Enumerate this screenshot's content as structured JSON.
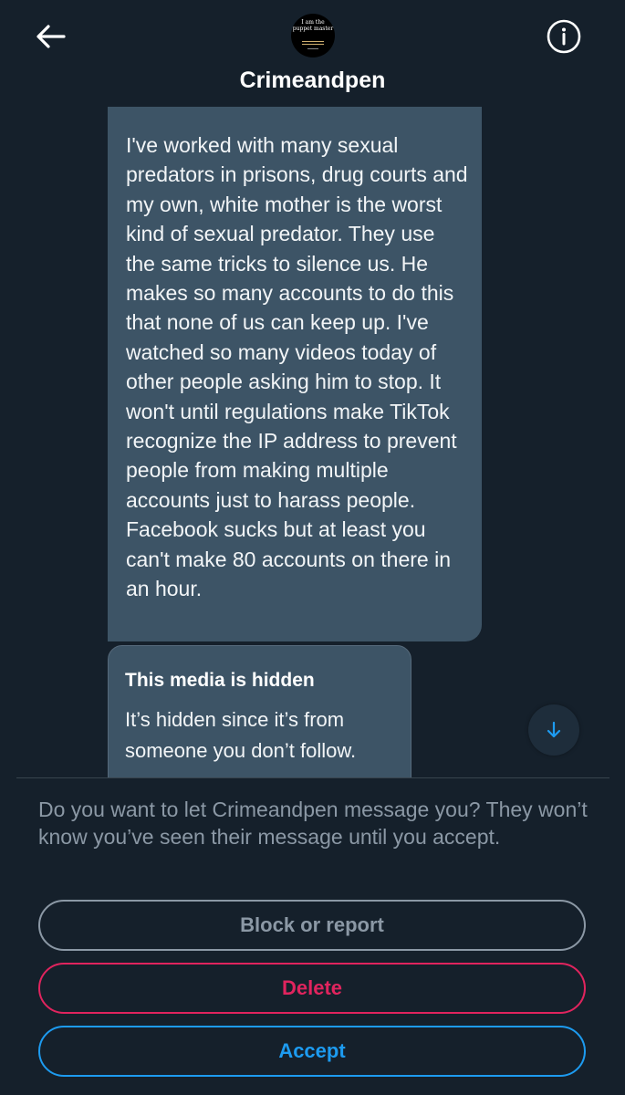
{
  "header": {
    "contact_name": "Crimeandpen",
    "avatar_text": "I am the puppet master",
    "back_icon": "arrow-left-icon",
    "info_icon": "info-circle-icon"
  },
  "messages": {
    "main_text": "I've worked with many sexual predators in prisons, drug courts and my own, white mother is the worst kind of sexual predator. They use the same tricks to silence us. He makes so many accounts to do this that none of us can keep up. I've watched so many videos today of other people asking him to stop. It won't until regulations make TikTok recognize the IP address to prevent people from making multiple accounts just to harass people. Facebook sucks but at least you can't make 80 accounts on there in an hour.",
    "hidden_media": {
      "title": "This media is hidden",
      "description": "It’s hidden since it’s from someone you don’t follow."
    },
    "scroll_icon": "arrow-down-icon"
  },
  "request_panel": {
    "message": "Do you want to let Crimeandpen message you? They won’t know you’ve seen their message until you accept.",
    "block_label": "Block or report",
    "delete_label": "Delete",
    "accept_label": "Accept"
  },
  "colors": {
    "background": "#15202b",
    "bubble": "#3d5466",
    "muted": "#8b98a5",
    "danger": "#e0245e",
    "accent": "#1d9bf0"
  }
}
